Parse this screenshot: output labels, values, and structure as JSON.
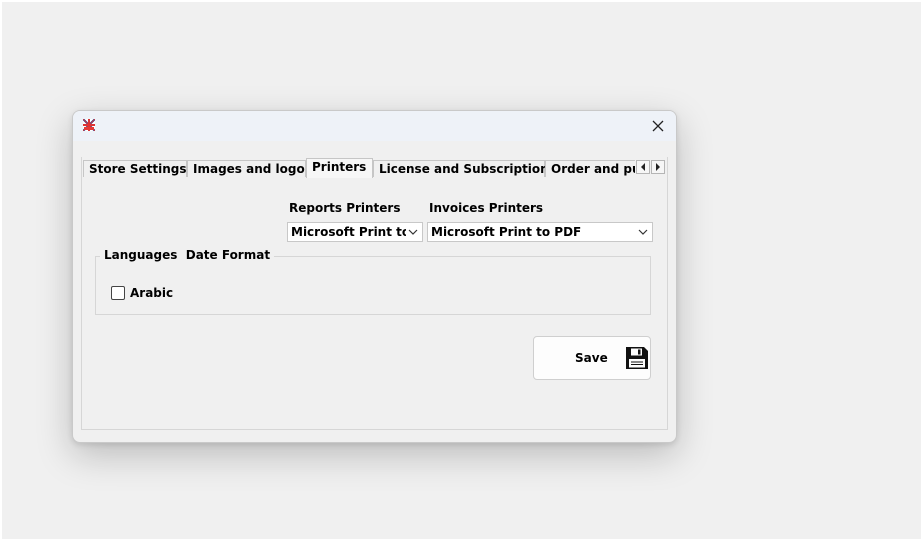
{
  "window": {
    "close_glyph": "×"
  },
  "tabs": [
    {
      "label": "Store Settings",
      "selected": false
    },
    {
      "label": "Images and logo",
      "selected": false
    },
    {
      "label": "Printers",
      "selected": true
    },
    {
      "label": "License and Subscription",
      "selected": false
    },
    {
      "label": "Order and pu",
      "selected": false
    }
  ],
  "printers": {
    "reports_label": "Reports Printers",
    "reports_value": "Microsoft Print to",
    "invoices_label": "Invoices Printers",
    "invoices_value": "Microsoft Print to PDF"
  },
  "languages_group": {
    "legend": "Languages  Date Format",
    "arabic_label": "Arabic",
    "arabic_checked": false
  },
  "save": {
    "label": "Save"
  },
  "icons": {
    "app": "app-logo-icon",
    "close": "close-icon",
    "tab_left": "chevron-left-icon",
    "tab_right": "chevron-right-icon",
    "dropdown": "chevron-down-icon",
    "save": "floppy-disk-icon"
  },
  "colors": {
    "desktop": "#f0f0f0",
    "titlebar": "#eef2f8",
    "window": "#f0f0f0",
    "field_bg": "#ffffff"
  }
}
